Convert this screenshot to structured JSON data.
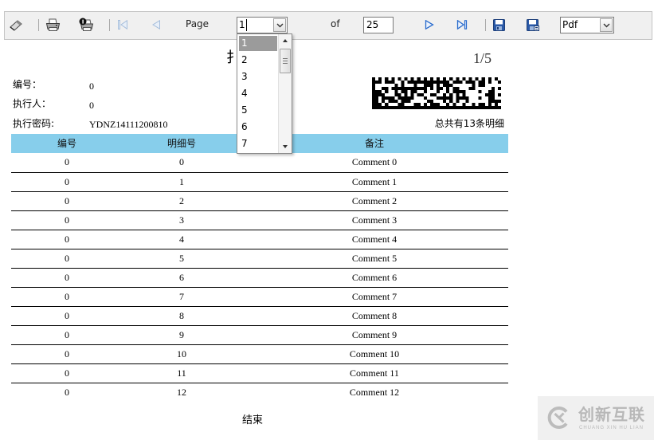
{
  "toolbar": {
    "page_label": "Page",
    "page_value": "1",
    "of_label": "of",
    "total_pages": "25",
    "format_value": "Pdf",
    "icons": {
      "edit": "pencil-icon",
      "print": "printer-icon",
      "print_page": "print-page-icon",
      "first_page": "first-page-icon",
      "previous_page": "previous-page-icon",
      "next_page": "next-page-icon",
      "last_page": "last-page-icon",
      "save": "save-icon",
      "save_as": "save-as-icon"
    }
  },
  "page_dropdown": {
    "options": [
      "1",
      "2",
      "3",
      "4",
      "5",
      "6",
      "7"
    ],
    "selected_index": 0
  },
  "report": {
    "title": "扌",
    "page_indicator": "1/5",
    "fields": [
      {
        "label": "编号：",
        "value": "0"
      },
      {
        "label": "执行人：",
        "value": "0"
      },
      {
        "label": "执行密码:",
        "value": "YDNZ14111200810"
      }
    ],
    "summary": "总共有13条明细",
    "table": {
      "headers": [
        "编号",
        "明细号",
        "备注"
      ],
      "rows": [
        [
          "0",
          "0",
          "Comment 0"
        ],
        [
          "0",
          "1",
          "Comment 1"
        ],
        [
          "0",
          "2",
          "Comment 2"
        ],
        [
          "0",
          "3",
          "Comment 3"
        ],
        [
          "0",
          "4",
          "Comment 4"
        ],
        [
          "0",
          "5",
          "Comment 5"
        ],
        [
          "0",
          "6",
          "Comment 6"
        ],
        [
          "0",
          "7",
          "Comment 7"
        ],
        [
          "0",
          "8",
          "Comment 8"
        ],
        [
          "0",
          "9",
          "Comment 9"
        ],
        [
          "0",
          "10",
          "Comment 10"
        ],
        [
          "0",
          "11",
          "Comment 11"
        ],
        [
          "0",
          "12",
          "Comment 12"
        ]
      ]
    },
    "footer": "结束"
  },
  "watermark": {
    "name": "创新互联",
    "subtitle": "CHUANG XIN HU LIAN"
  },
  "colors": {
    "toolbar_bg": "#f0f0f0",
    "table_header_bg": "#87ceeb",
    "dropdown_highlight": "#9b9b9b",
    "nav_enabled": "#2a6ccd",
    "nav_disabled": "#a6bedb",
    "save_icon": "#2b5aa8",
    "watermark_text": "#b8b8b8"
  }
}
